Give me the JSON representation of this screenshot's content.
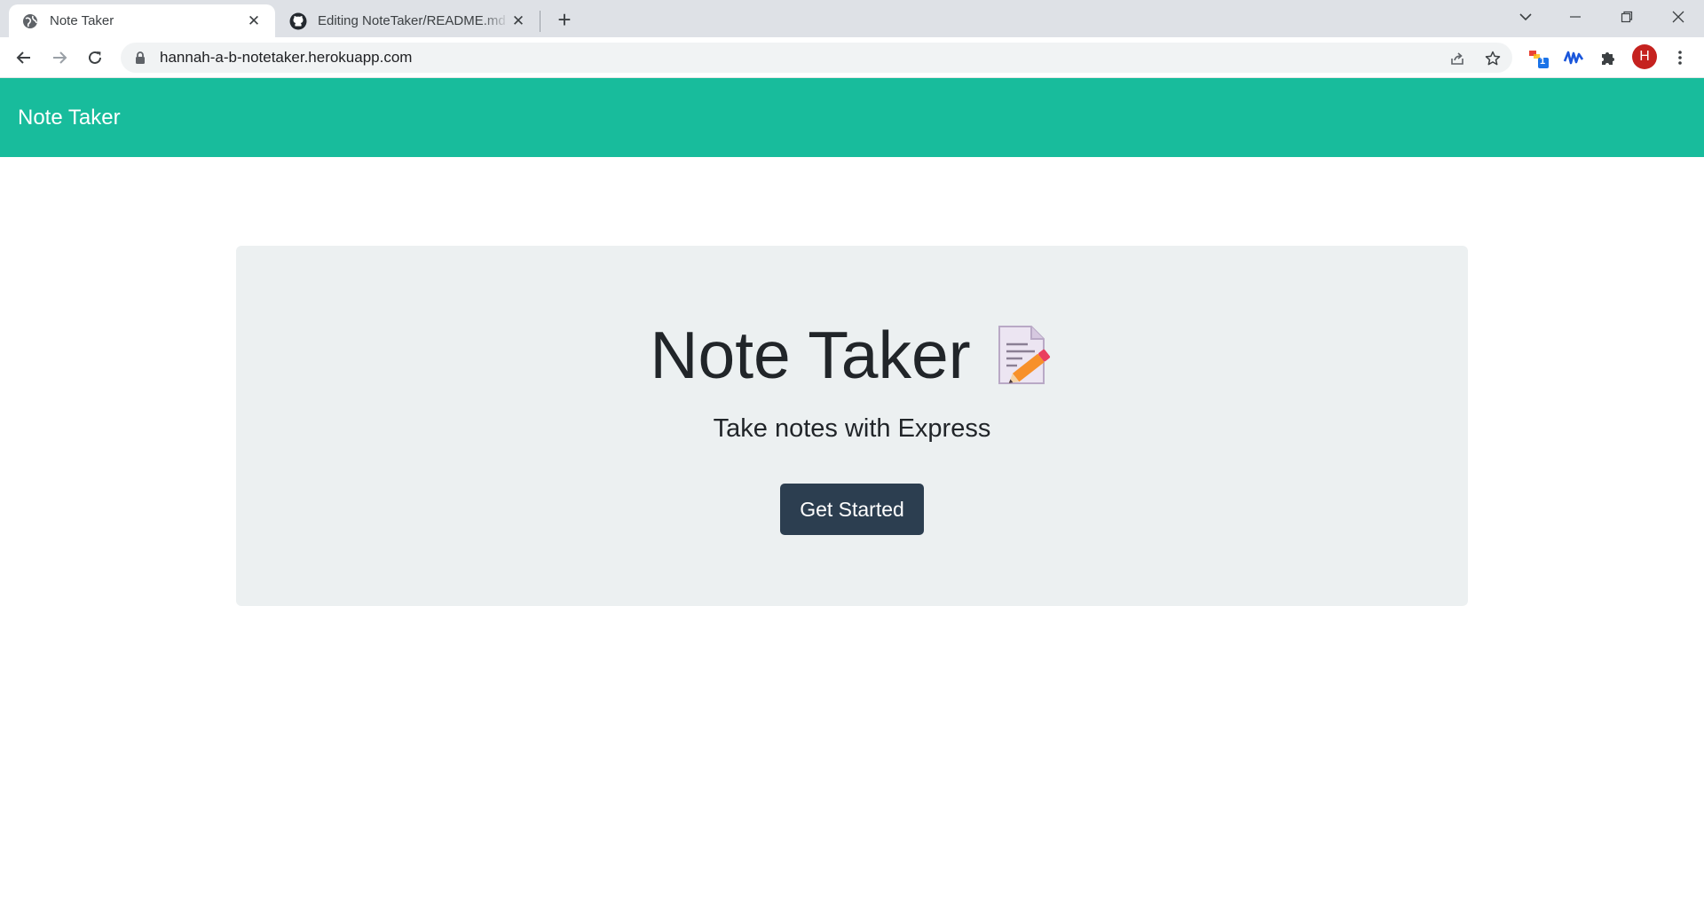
{
  "browser": {
    "tabs": [
      {
        "title": "Note Taker",
        "active": true,
        "icon": "globe-icon"
      },
      {
        "title": "Editing NoteTaker/README.md at",
        "active": false,
        "icon": "github-icon"
      }
    ],
    "url": "hannah-a-b-notetaker.herokuapp.com",
    "extension_badge": "1",
    "profile_initial": "H",
    "new_tab_glyph": "+",
    "close_glyph": "✕"
  },
  "page": {
    "brand": "Note Taker",
    "heading": "Note Taker",
    "lead": "Take notes with Express",
    "cta_label": "Get Started"
  },
  "colors": {
    "navbar": "#18bc9c",
    "jumbotron": "#ecf0f1",
    "button": "#2c3e50",
    "avatar": "#c5221f"
  }
}
